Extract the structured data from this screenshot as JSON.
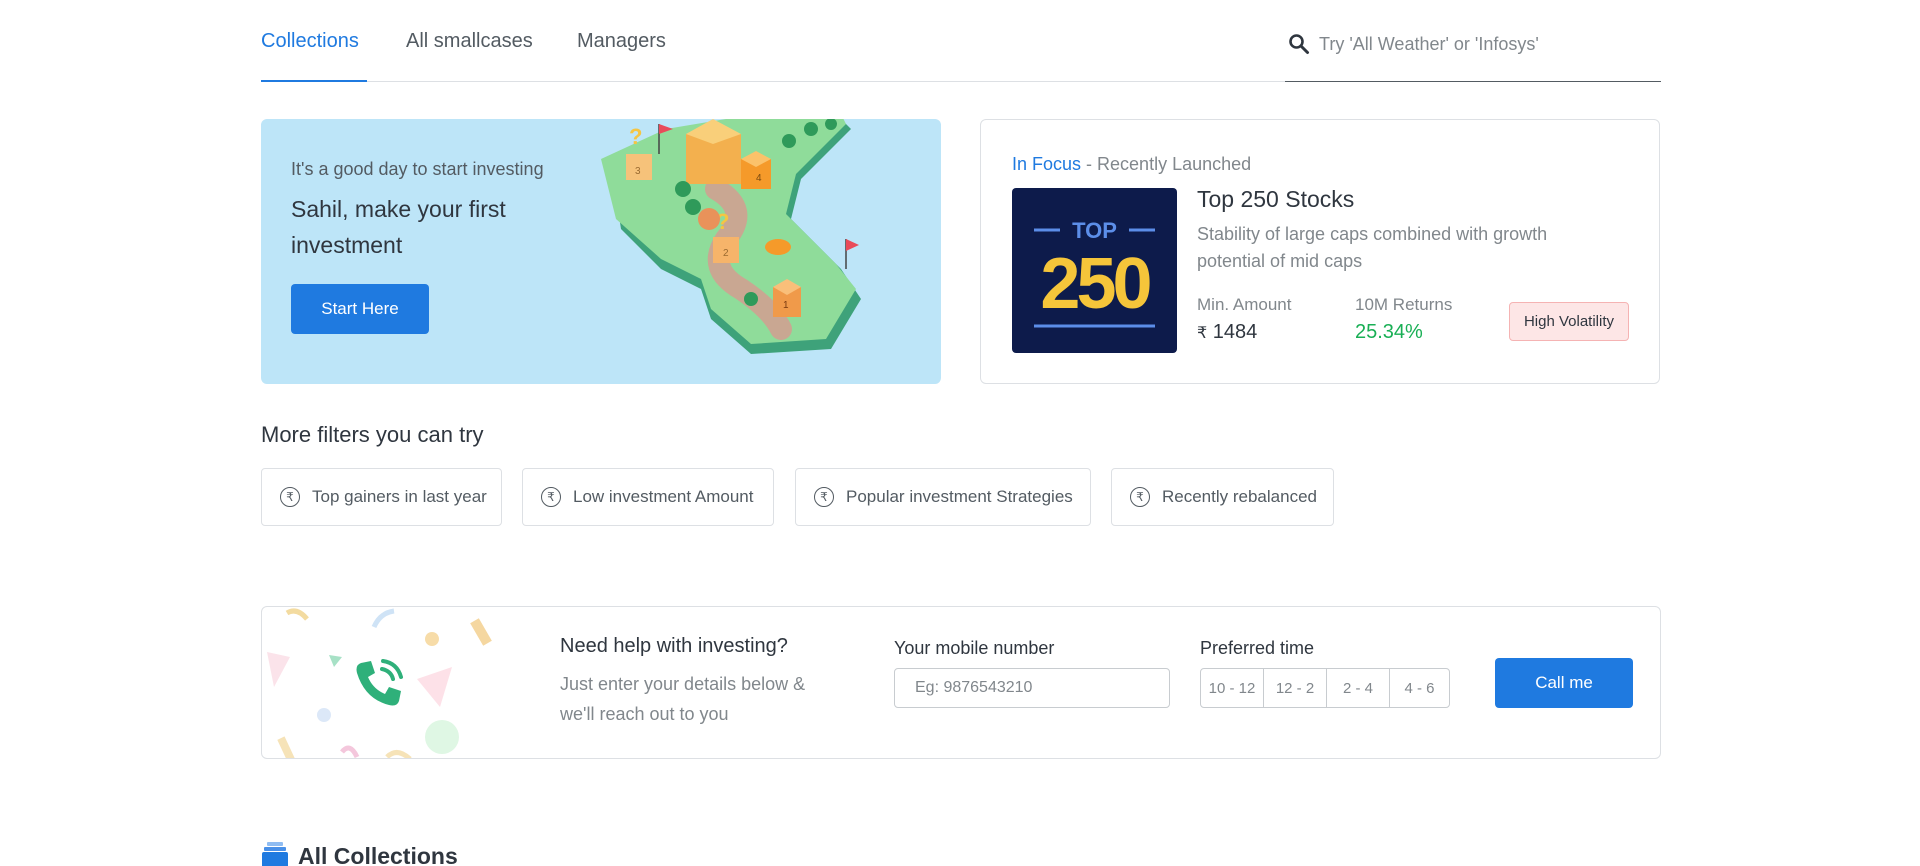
{
  "nav": {
    "tabs": [
      {
        "label": "Collections",
        "active": true
      },
      {
        "label": "All smallcases",
        "active": false
      },
      {
        "label": "Managers",
        "active": false
      }
    ],
    "search": {
      "placeholder": "Try 'All Weather' or 'Infosys'",
      "icon": "search-icon"
    }
  },
  "hero": {
    "subtitle": "It's a good day to start investing",
    "title": "Sahil, make your first investment",
    "button": "Start Here"
  },
  "focus": {
    "highlight": "In Focus",
    "separator": " - ",
    "tag": "Recently Launched",
    "thumb_top": "TOP",
    "thumb_number": "250",
    "name": "Top 250 Stocks",
    "description": "Stability of large caps combined with growth potential of mid caps",
    "min_amount_label": "Min. Amount",
    "currency": "₹",
    "min_amount_value": "1484",
    "returns_label": "10M Returns",
    "returns_value": "25.34%",
    "volatility": "High Volatility"
  },
  "filters": {
    "title": "More filters you can try",
    "icon": "₹",
    "items": [
      "Top gainers in last year",
      "Low investment Amount",
      "Popular investment Strategies",
      "Recently rebalanced"
    ]
  },
  "help": {
    "title": "Need help with investing?",
    "description": "Just enter your details below & we'll reach out to you",
    "mobile_label": "Your mobile number",
    "mobile_placeholder": "Eg: 9876543210",
    "time_label": "Preferred time",
    "slots": [
      "10 - 12",
      "12 - 2",
      "2 - 4",
      "4 - 6"
    ],
    "button": "Call me"
  },
  "all_collections": {
    "title": "All Collections"
  },
  "colors": {
    "accent": "#1f7ae0",
    "positive": "#19af55",
    "hero_bg": "#bde5f8",
    "badge_bg": "#fde6e6"
  }
}
